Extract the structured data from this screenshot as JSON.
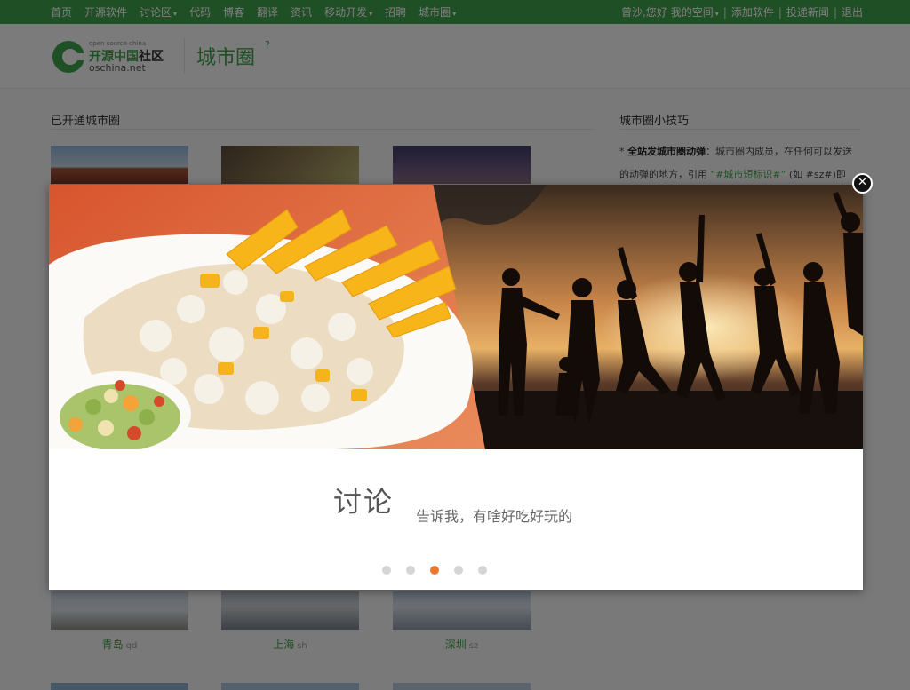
{
  "topnav": {
    "items": [
      {
        "label": "首页",
        "dropdown": false
      },
      {
        "label": "开源软件",
        "dropdown": false
      },
      {
        "label": "讨论区",
        "dropdown": true
      },
      {
        "label": "代码",
        "dropdown": false
      },
      {
        "label": "博客",
        "dropdown": false
      },
      {
        "label": "翻译",
        "dropdown": false
      },
      {
        "label": "资讯",
        "dropdown": false
      },
      {
        "label": "移动开发",
        "dropdown": true
      },
      {
        "label": "招聘",
        "dropdown": false
      },
      {
        "label": "城市圈",
        "dropdown": true
      }
    ],
    "greeting": "曾沙,您好",
    "my_space": "我的空间",
    "add_software": "添加软件",
    "submit_news": "投递新闻",
    "logout": "退出",
    "caret": "▾",
    "separator": "|"
  },
  "header": {
    "logo_tag": "open source china",
    "logo_cn_green": "开源中国",
    "logo_cn_dark": "社区",
    "logo_en": "oschina.net",
    "page_title": "城市圈",
    "help_mark": "?"
  },
  "main": {
    "section_title": "已开通城市圈",
    "cities": [
      {
        "name": "青岛",
        "abbr": "qd"
      },
      {
        "name": "上海",
        "abbr": "sh"
      },
      {
        "name": "深圳",
        "abbr": "sz"
      }
    ]
  },
  "sidebar": {
    "title": "城市圈小技巧",
    "tip_bullet": "* ",
    "tip_bold": "全站发城市圈动弹",
    "tip_text": "：城市圈内成员，在任何可以发送的动弹的地方，引用",
    "tip_code": "“#城市短标识#”",
    "tip_tail": "(如 #sz#)即"
  },
  "modal": {
    "heading": "讨论",
    "subtitle": "告诉我，有啥好吃好玩的",
    "slide_count": 5,
    "active_slide": 3,
    "close_glyph": "✕"
  },
  "colors": {
    "brand_green": "#3e9e4a",
    "active_dot": "#e8792f",
    "inactive_dot": "#d5d5d5"
  }
}
